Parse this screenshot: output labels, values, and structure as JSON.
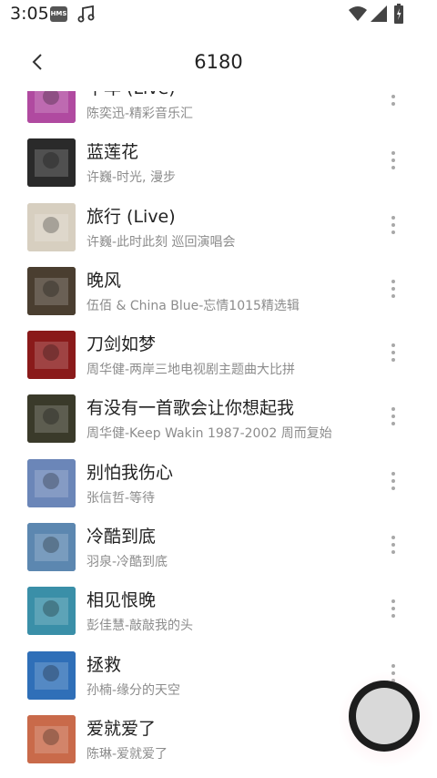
{
  "status_bar": {
    "time": "3:05",
    "hms_label": "HMS",
    "icons": [
      "hms-icon",
      "music-note-icon",
      "wifi-icon",
      "signal-icon",
      "battery-icon"
    ]
  },
  "header": {
    "title": "6180",
    "back_icon": "chevron-left-icon"
  },
  "songs": [
    {
      "title": "十年 (Live)",
      "subtitle": "陈奕迅-精彩音乐汇",
      "cover_color": "#b04aa0"
    },
    {
      "title": "蓝莲花",
      "subtitle": "许巍-时光, 漫步",
      "cover_color": "#2a2a2a"
    },
    {
      "title": "旅行 (Live)",
      "subtitle": "许巍-此时此刻 巡回演唱会",
      "cover_color": "#d7cfc0"
    },
    {
      "title": "晚风",
      "subtitle": "伍佰 & China Blue-忘情1015精选辑",
      "cover_color": "#4a3e30"
    },
    {
      "title": "刀剑如梦",
      "subtitle": "周华健-两岸三地电视剧主题曲大比拼",
      "cover_color": "#8a1a1a"
    },
    {
      "title": "有没有一首歌会让你想起我",
      "subtitle": "周华健-Keep Wakin 1987-2002 周而复始",
      "cover_color": "#3a3a2a"
    },
    {
      "title": "别怕我伤心",
      "subtitle": "张信哲-等待",
      "cover_color": "#6b86b8"
    },
    {
      "title": "冷酷到底",
      "subtitle": "羽泉-冷酷到底",
      "cover_color": "#5c87b0"
    },
    {
      "title": "相见恨晚",
      "subtitle": "彭佳慧-敲敲我的头",
      "cover_color": "#3a8fa8"
    },
    {
      "title": "拯救",
      "subtitle": "孙楠-缘分的天空",
      "cover_color": "#2f6fb8"
    },
    {
      "title": "爱就爱了",
      "subtitle": "陈琳-爱就爱了",
      "cover_color": "#c96a4a"
    }
  ],
  "more_icon": "more-vertical-icon",
  "player": {
    "icon": "mini-player-disc-icon"
  }
}
